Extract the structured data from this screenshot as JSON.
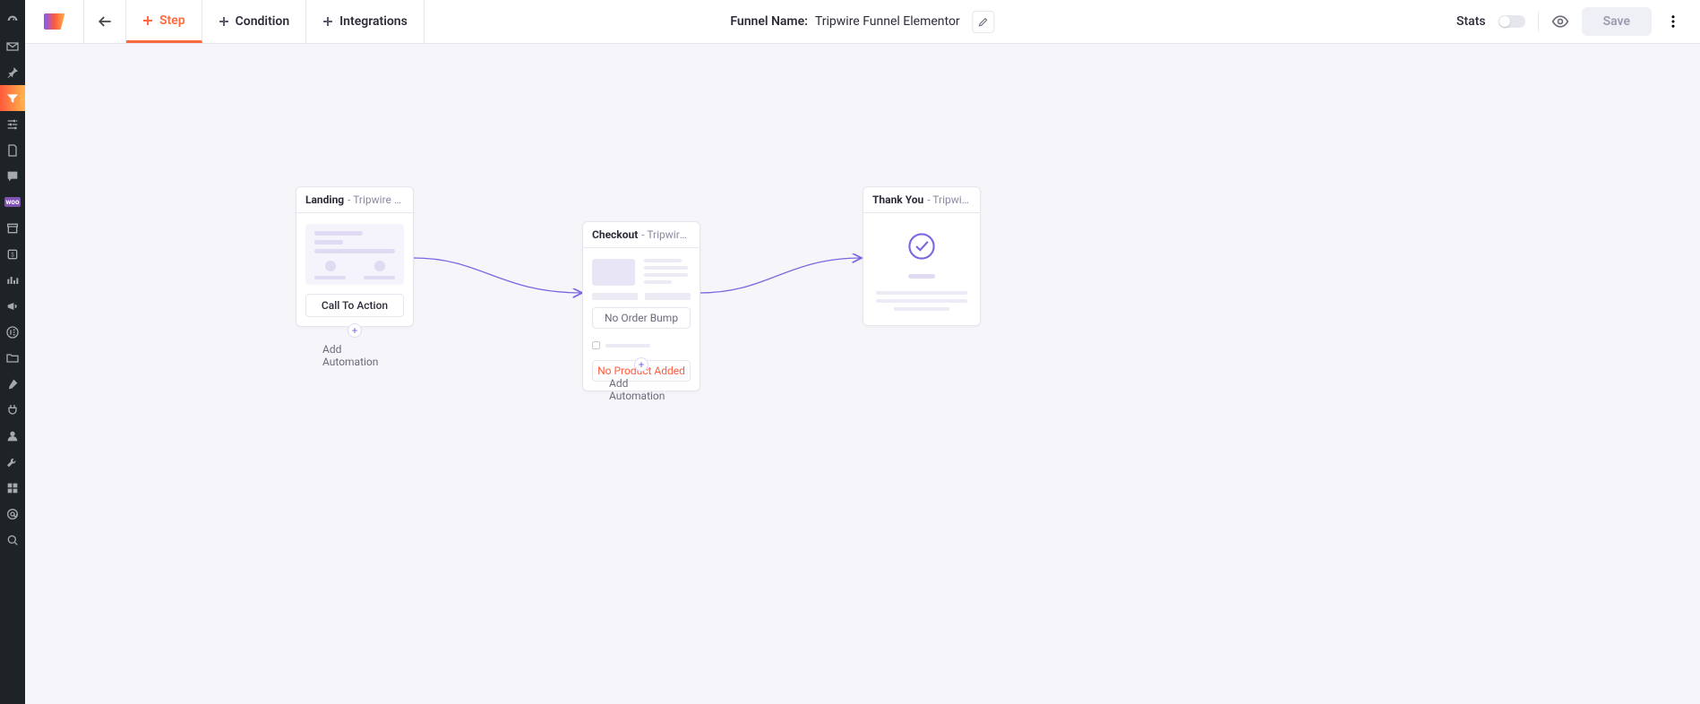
{
  "header": {
    "tabs": {
      "step": "Step",
      "condition": "Condition",
      "integrations": "Integrations"
    },
    "funnel_label": "Funnel Name:",
    "funnel_name": "Tripwire Funnel Elementor",
    "stats_label": "Stats",
    "save_label": "Save"
  },
  "sidebar_icons": [
    "dashboard",
    "mail",
    "pin",
    "funnels",
    "settings-alt",
    "pages",
    "comments",
    "woo",
    "media",
    "payments",
    "analytics",
    "marketing",
    "elementor",
    "files",
    "tools",
    "plugins",
    "users",
    "wrench",
    "theme",
    "mentions",
    "search"
  ],
  "steps": {
    "landing": {
      "name": "Landing",
      "sub": "- Tripwire Funne…",
      "cta": "Call To Action",
      "add_auto": "Add Automation"
    },
    "checkout": {
      "name": "Checkout",
      "sub": "- Tripwire Funne…",
      "order_bump": "No Order Bump",
      "no_product": "No Product Added",
      "add_auto": "Add Automation"
    },
    "thankyou": {
      "name": "Thank You",
      "sub": "- Tripwire Funne…"
    }
  },
  "colors": {
    "accent": "#ff6a3d",
    "purple": "#7968e0"
  }
}
